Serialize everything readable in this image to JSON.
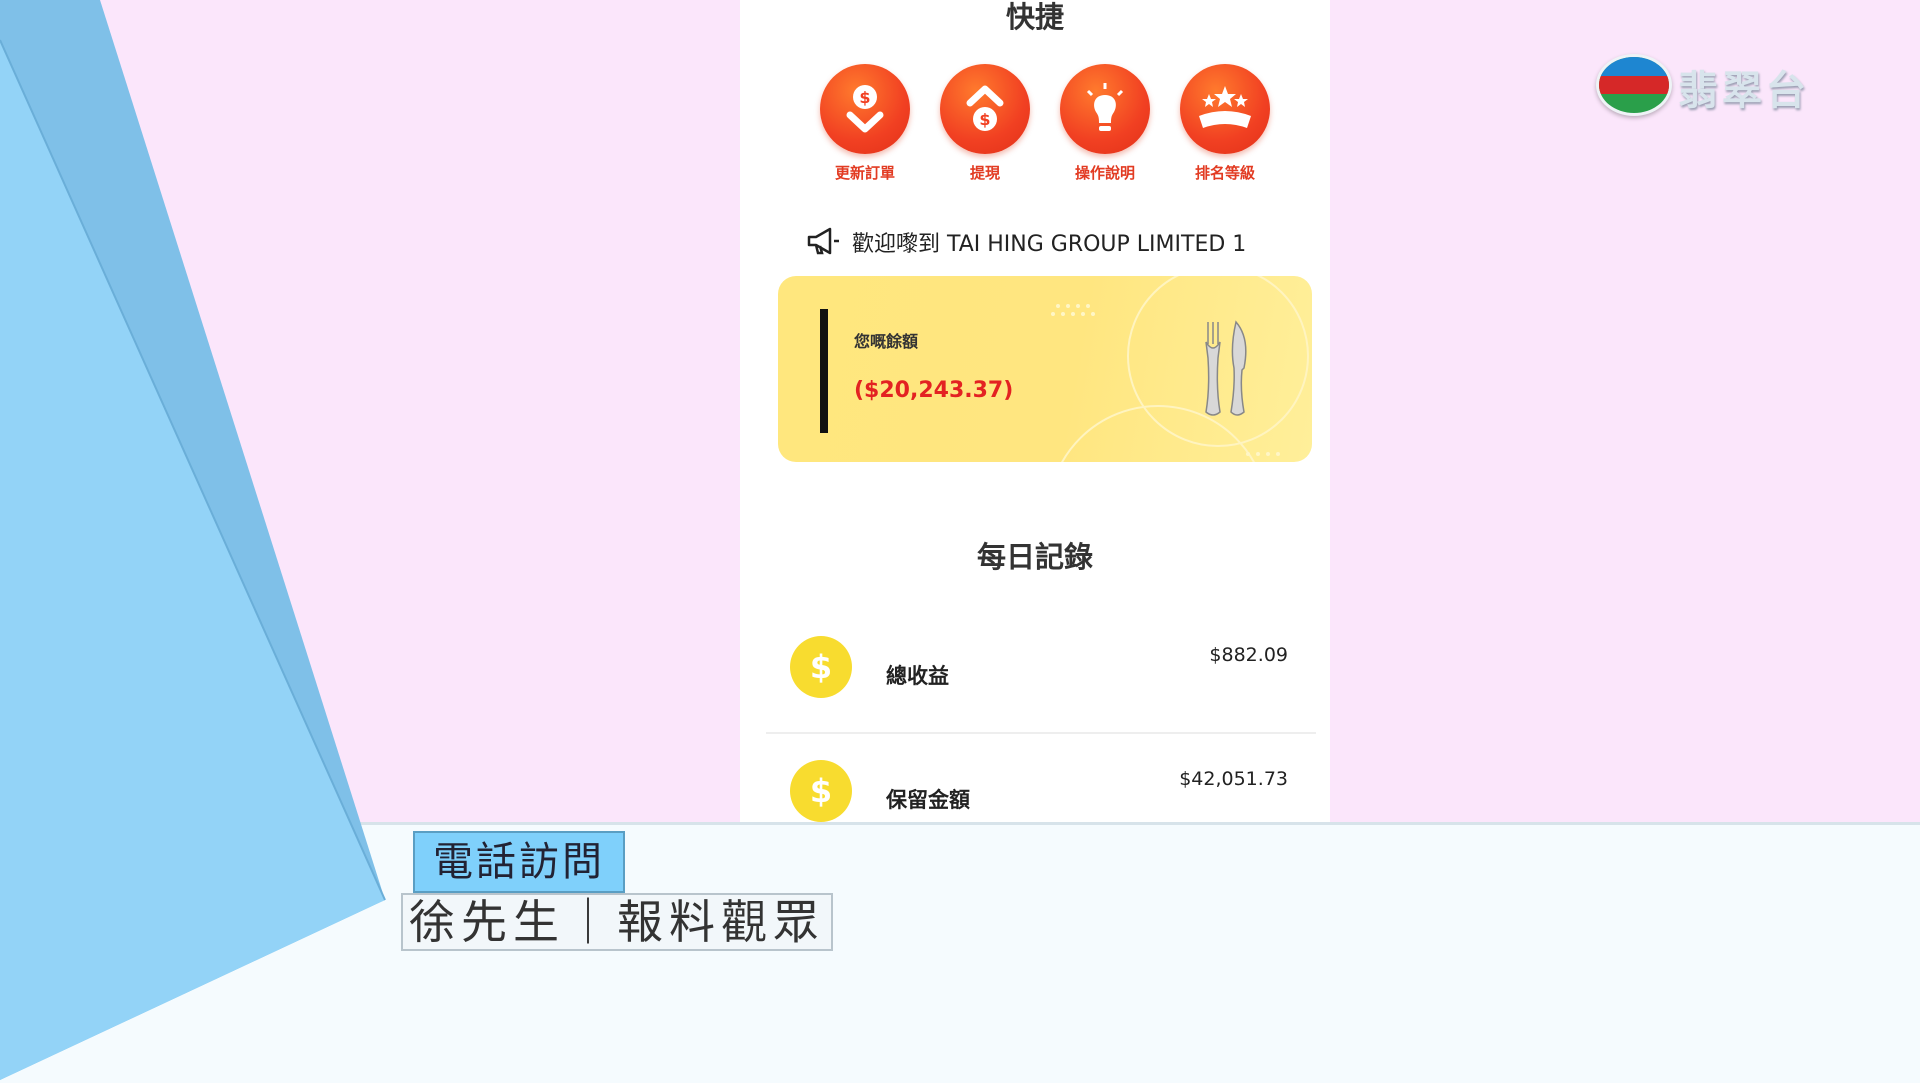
{
  "channel_logo": {
    "name": "翡翠台"
  },
  "app": {
    "quick_title": "快捷",
    "actions": [
      {
        "label": "更新訂單",
        "icon": "dollar-down-icon"
      },
      {
        "label": "提現",
        "icon": "dollar-up-icon"
      },
      {
        "label": "操作說明",
        "icon": "lightbulb-icon"
      },
      {
        "label": "排名等級",
        "icon": "ranking-stars-icon"
      }
    ],
    "announcement": "歡迎嚟到 TAI HING GROUP LIMITED 1",
    "balance": {
      "label": "您嘅餘額",
      "amount": "($20,243.37)"
    },
    "daily_title": "每日記錄",
    "records": [
      {
        "label": "總收益",
        "value": "$882.09",
        "icon": "dollar-coin-icon"
      },
      {
        "label": "保留金額",
        "value": "$42,051.73",
        "icon": "dollar-coin-icon"
      }
    ]
  },
  "caption": {
    "tag": "電話訪問",
    "name": "徐先生｜報料觀眾"
  },
  "colors": {
    "accent_orange": "#f14022",
    "card_yellow": "#ffe680",
    "balance_red": "#e32222",
    "coin_yellow": "#f8dc2f",
    "tag_blue": "#7fd0fb"
  }
}
